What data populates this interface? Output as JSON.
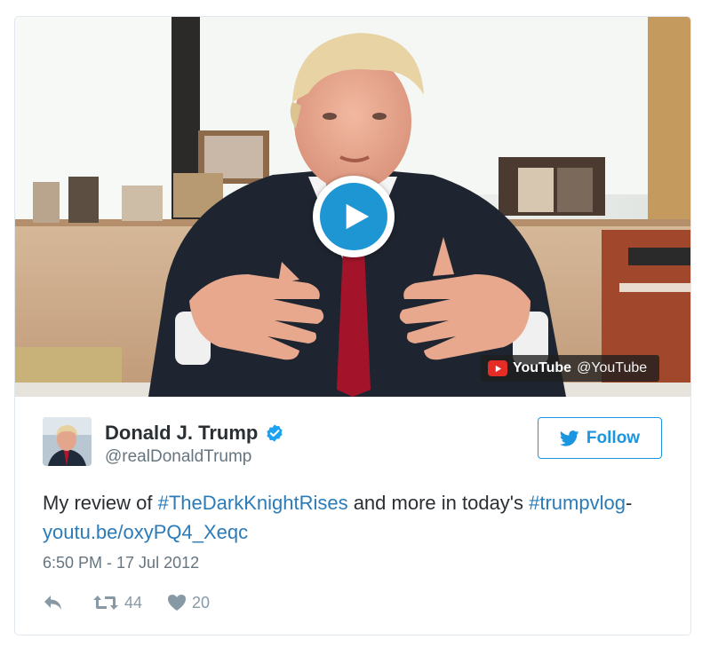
{
  "media": {
    "play_icon": "play-icon",
    "source_badge": {
      "icon": "youtube-logo-icon",
      "name": "YouTube",
      "handle": "@YouTube"
    }
  },
  "author": {
    "name": "Donald J. Trump",
    "handle": "@realDonaldTrump",
    "verified": true,
    "verified_icon": "verified-badge-icon"
  },
  "follow": {
    "icon": "twitter-bird-icon",
    "label": "Follow"
  },
  "tweet": {
    "text_before": "My review of ",
    "hashtag1": "#TheDarkKnightRises",
    "text_middle": " and more in today's ",
    "hashtag2": "#trumpvlog",
    "text_sep": "- ",
    "link": "youtu.be/oxyPQ4_Xeqc"
  },
  "timestamp": "6:50 PM - 17 Jul 2012",
  "actions": {
    "reply_icon": "reply-icon",
    "retweet_icon": "retweet-icon",
    "retweet_count": "44",
    "like_icon": "heart-icon",
    "like_count": "20"
  },
  "colors": {
    "link": "#2b7bb9",
    "follow": "#1b95e0",
    "play": "#1e96d4",
    "youtube_red": "#e52d27",
    "meta_gray": "#66757f"
  }
}
